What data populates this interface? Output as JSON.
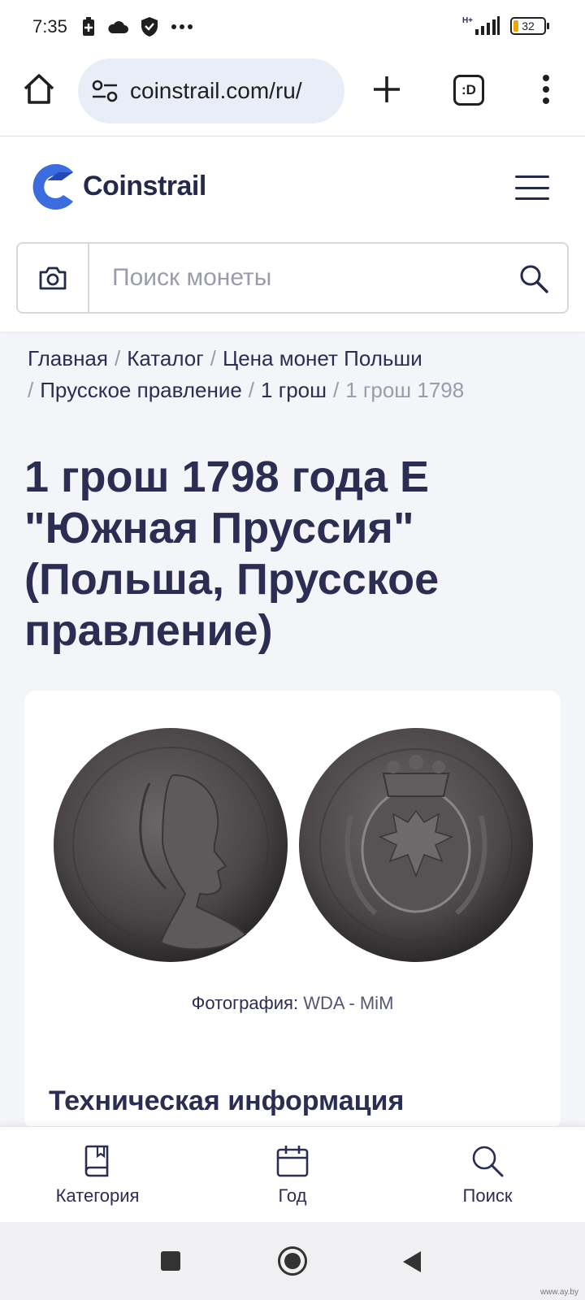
{
  "status_bar": {
    "time": "7:35",
    "battery_level": "32",
    "left_icons": [
      "battery-saver-icon",
      "cloud-icon",
      "shield-icon",
      "more-dots-icon"
    ],
    "right_icons": [
      "signal-icon",
      "battery-icon"
    ],
    "network": "H+"
  },
  "browser": {
    "url": "coinstrail.com/ru/",
    "tabs_label": ":D",
    "icons": [
      "home-icon",
      "site-settings-icon",
      "new-tab-icon",
      "tabs-icon",
      "overflow-menu-icon"
    ]
  },
  "site": {
    "brand": "Coinstrail",
    "brand_color": "#3b6de0",
    "search": {
      "placeholder": "Поиск монеты",
      "value": ""
    }
  },
  "breadcrumb": {
    "items": [
      "Главная",
      "Каталог",
      "Цена монет Польши",
      "Прусское правление",
      "1 грош"
    ],
    "current": "1 грош 1798",
    "separator": "/"
  },
  "page": {
    "title": "1 грош 1798 года E \"Южная Пруссия\" (Польша, Прусское правление)"
  },
  "coin_card": {
    "photo_label": "Фотография:",
    "photo_source": "WDA - MiM",
    "section_title": "Техническая информация"
  },
  "bottom_nav": [
    {
      "label": "Категория",
      "icon": "book-icon"
    },
    {
      "label": "Год",
      "icon": "calendar-icon"
    },
    {
      "label": "Поиск",
      "icon": "search-icon"
    }
  ],
  "watermark": "www.ay.by"
}
